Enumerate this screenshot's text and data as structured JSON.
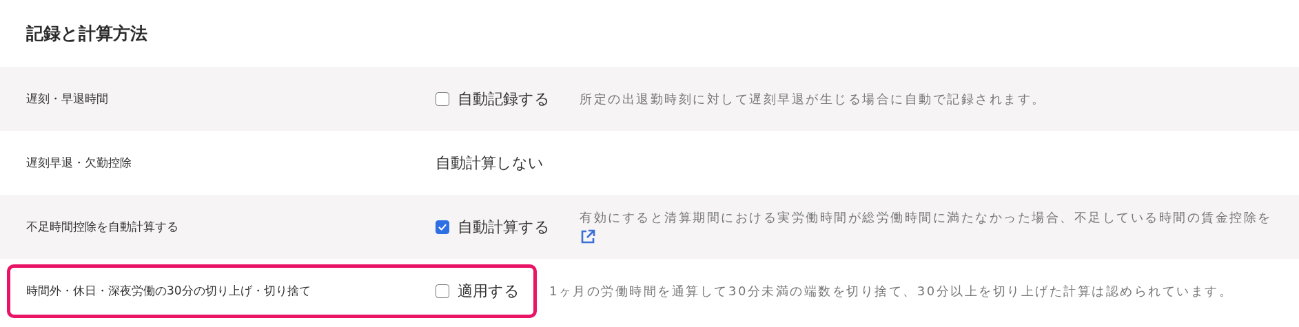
{
  "section_title": "記録と計算方法",
  "rows": [
    {
      "label": "遅刻・早退時間",
      "control": {
        "kind": "checkbox",
        "label": "自動記録する",
        "checked": false
      },
      "description": "所定の出退勤時刻に対して遅刻早退が生じる場合に自動で記録されます。",
      "external_link": false,
      "highlighted": false
    },
    {
      "label": "遅刻早退・欠勤控除",
      "control": {
        "kind": "text",
        "label": "自動計算しない"
      },
      "external_link": false,
      "highlighted": false
    },
    {
      "label": "不足時間控除を自動計算する",
      "control": {
        "kind": "checkbox",
        "label": "自動計算する",
        "checked": true
      },
      "description": "有効にすると清算期間における実労働時間が総労働時間に満たなかった場合、不足している時間の賃金控除を",
      "external_link": true,
      "highlighted": false
    },
    {
      "label": "時間外・休日・深夜労働の30分の切り上げ・切り捨て",
      "control": {
        "kind": "checkbox",
        "label": "適用する",
        "checked": false
      },
      "description": "1ヶ月の労働時間を通算して30分未満の端数を切り捨て、30分以上を切り上げた計算は認められています。",
      "external_link": false,
      "highlighted": true
    }
  ]
}
